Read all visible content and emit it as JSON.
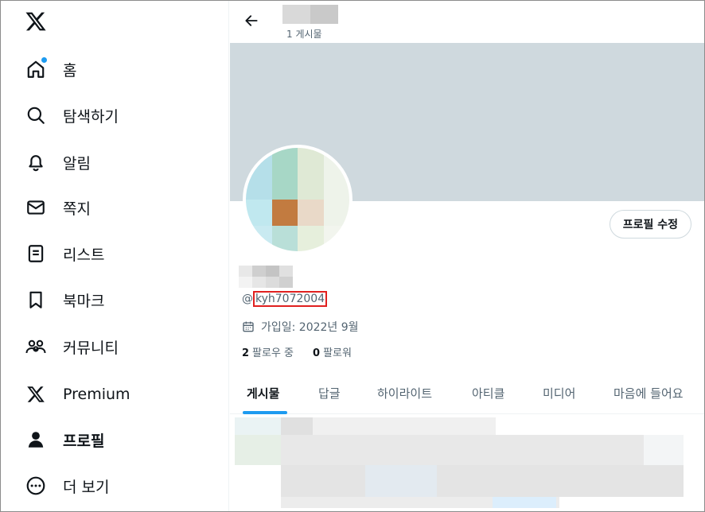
{
  "sidebar": {
    "items": [
      {
        "label": "홈",
        "icon": "home-icon",
        "has_notification": true
      },
      {
        "label": "탐색하기",
        "icon": "search-icon"
      },
      {
        "label": "알림",
        "icon": "bell-icon"
      },
      {
        "label": "쪽지",
        "icon": "mail-icon"
      },
      {
        "label": "리스트",
        "icon": "list-icon"
      },
      {
        "label": "북마크",
        "icon": "bookmark-icon"
      },
      {
        "label": "커뮤니티",
        "icon": "communities-icon"
      },
      {
        "label": "Premium",
        "icon": "x-logo-icon"
      },
      {
        "label": "프로필",
        "icon": "person-icon",
        "active": true
      },
      {
        "label": "더 보기",
        "icon": "more-circle-icon"
      }
    ]
  },
  "header": {
    "post_count": "1 게시물"
  },
  "profile": {
    "edit_button": "프로필 수정",
    "handle_prefix": "@",
    "handle": "kyh7072004",
    "joined": "가입일: 2022년 9월",
    "following_count": "2",
    "following_label": "팔로우 중",
    "followers_count": "0",
    "followers_label": "팔로워"
  },
  "tabs": [
    "게시물",
    "답글",
    "하이라이트",
    "아티클",
    "미디어",
    "마음에 들어요"
  ],
  "colors": {
    "accent": "#1d9bf0",
    "banner": "#cfd9de",
    "highlight_box": "#e0201f",
    "secondary_text": "#536471"
  }
}
